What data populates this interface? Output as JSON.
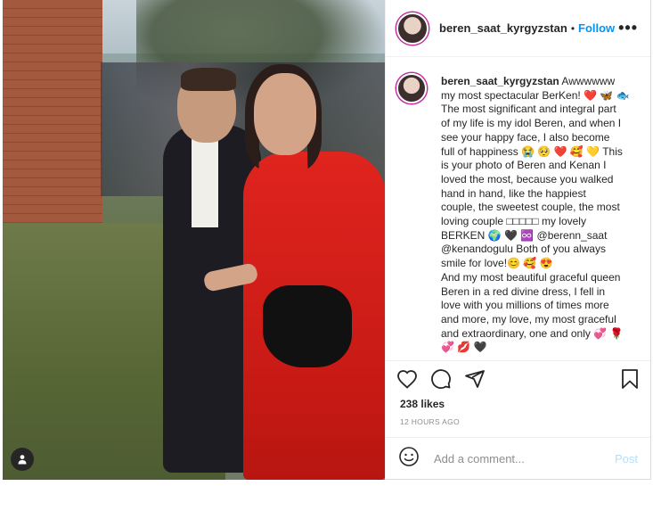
{
  "post": {
    "username": "beren_saat_kyrgyzstan",
    "separator": "•",
    "follow_label": "Follow",
    "more_label": "•••",
    "caption_lines": [
      "Awwwwww",
      "my most spectacular BerKen! ❤️ 🦋 🐟",
      "The most significant and integral part",
      "of my life is my idol Beren, and when I",
      "see your happy face, I also become",
      "full of happiness 😭 🥺 ❤️ 🥰 💛 This",
      "is your photo of Beren and Kenan I",
      "loved the most, because you walked",
      "hand in hand, like the happiest",
      "couple, the sweetest couple, the most",
      "loving couple □□□□□ my lovely",
      "BERKEN 🌍 🖤 ♾️ @berenn_saat",
      "@kenandogulu Both of you always",
      "smile for love!😊 🥰 😍",
      "And my most beautiful graceful queen",
      "Beren in a red divine dress, I fell in",
      "love with you millions of times more",
      "and more, my love, my most graceful",
      "and extraordinary, one and only 💞 🌹",
      "💞 💋 🖤"
    ],
    "likes": "238 likes",
    "timestamp": "12 HOURS AGO",
    "comment_placeholder": "Add a comment...",
    "post_label": "Post"
  },
  "icons": {
    "like": "heart-icon",
    "comment": "comment-icon",
    "share": "share-icon",
    "save": "bookmark-icon",
    "emoji": "emoji-icon",
    "user_tag": "user-tag-icon"
  },
  "colors": {
    "follow": "#0095f6",
    "post_disabled": "#b2dffc",
    "muted": "#8e8e8e"
  }
}
